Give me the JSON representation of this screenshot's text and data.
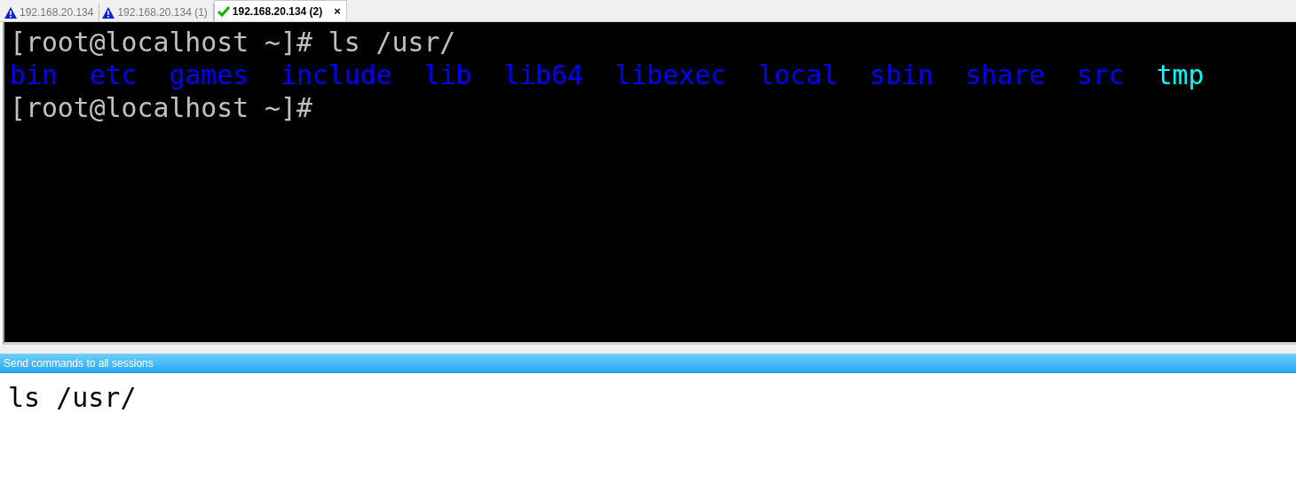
{
  "close_label": "×",
  "tabs": [
    {
      "label": "192.168.20.134",
      "kind": "warning",
      "selected": false
    },
    {
      "label": "192.168.20.134 (1)",
      "kind": "warning",
      "selected": false
    },
    {
      "label": "192.168.20.134 (2)",
      "kind": "ok",
      "selected": true
    }
  ],
  "terminal": {
    "lines": [
      {
        "kind": "prompt",
        "text": "[root@localhost ~]# ls /usr/"
      },
      {
        "kind": "listing",
        "items": [
          {
            "text": "bin",
            "color": "#0000ff"
          },
          {
            "text": "etc",
            "color": "#0000ff"
          },
          {
            "text": "games",
            "color": "#0000ff"
          },
          {
            "text": "include",
            "color": "#0000ff"
          },
          {
            "text": "lib",
            "color": "#0000ff"
          },
          {
            "text": "lib64",
            "color": "#0000ff"
          },
          {
            "text": "libexec",
            "color": "#0000ff"
          },
          {
            "text": "local",
            "color": "#0000ff"
          },
          {
            "text": "sbin",
            "color": "#0000ff"
          },
          {
            "text": "share",
            "color": "#0000ff"
          },
          {
            "text": "src",
            "color": "#0000ff"
          },
          {
            "text": "tmp",
            "color": "#00ffff"
          }
        ]
      },
      {
        "kind": "prompt",
        "text": "[root@localhost ~]#"
      }
    ]
  },
  "send_bar": {
    "title": "Send commands to all sessions",
    "value": "ls /usr/"
  }
}
